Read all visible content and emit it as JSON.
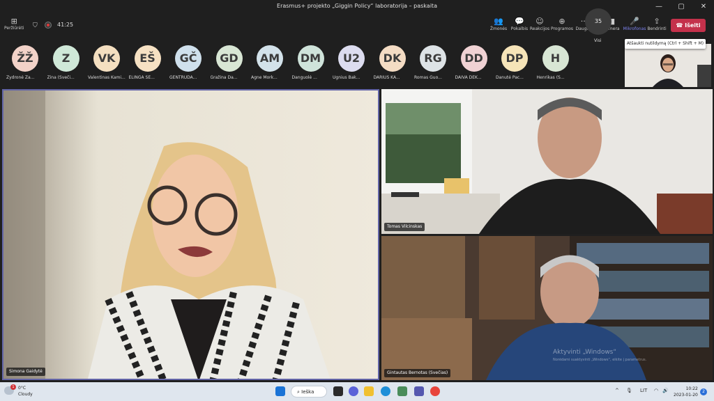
{
  "window": {
    "title": "Erasmus+ projekto „Giggin Policy“ laboratorija – paskaita",
    "minimize": "—",
    "maximize": "▢",
    "close": "✕"
  },
  "toolbar": {
    "layout_label": "Peržiūrėti",
    "timer": "41:25",
    "people_label": "Žmonės",
    "chat_label": "Pokalbis",
    "reactions_label": "Reakcijos",
    "apps_label": "Programos",
    "more_label": "Daugiau",
    "camera_label": "Kamera",
    "mic_label": "Mikrofonas",
    "share_label": "Bendrinti",
    "leave_label": "Išeiti",
    "unmute_tooltip": "Atšaukti nutildymą (Ctrl + Shift + M)"
  },
  "participants": [
    {
      "initials": "ŽŽ",
      "name": "Žydronė Ža...",
      "color": "#f2d2c8"
    },
    {
      "initials": "Z",
      "name": "Zina (Sveči...",
      "color": "#cfe8d8"
    },
    {
      "initials": "VK",
      "name": "Valentinas Kami...",
      "color": "#f4dfc0"
    },
    {
      "initials": "EŠ",
      "name": "ELINGA ŠE...",
      "color": "#f6e1c3"
    },
    {
      "initials": "GČ",
      "name": "GENTRŪDA...",
      "color": "#cfe0ec"
    },
    {
      "initials": "GD",
      "name": "Gražina Da...",
      "color": "#d8e6d4"
    },
    {
      "initials": "AM",
      "name": "Agne Mork...",
      "color": "#d3e2ea"
    },
    {
      "initials": "DM",
      "name": "Danguolė ...",
      "color": "#cfe3da"
    },
    {
      "initials": "U2",
      "name": "Ugnius Bak...",
      "color": "#dcdcef"
    },
    {
      "initials": "DK",
      "name": "DARIUS KA...",
      "color": "#f4dcc4"
    },
    {
      "initials": "RG",
      "name": "Romas Guo...",
      "color": "#dde3e6"
    },
    {
      "initials": "DD",
      "name": "DAIVA DEK...",
      "color": "#f0d2d4"
    },
    {
      "initials": "DP",
      "name": "Danutė Pac...",
      "color": "#f6e4b8"
    },
    {
      "initials": "H",
      "name": "Henrikas (S...",
      "color": "#d8e6d4"
    }
  ],
  "more_participants": {
    "count": "35",
    "label": "Visi"
  },
  "videos": {
    "main_name": "Simona Gaidytė",
    "top_right_name": "Tomas Vilcinskas",
    "bottom_right_name": "Gintautas Bernotas (Svečias)",
    "watermark_line1": "Aktyvinti „Windows“",
    "watermark_line2": "Norėdami suaktyvinti „Windows“, eikite į parametrus."
  },
  "taskbar": {
    "temperature": "0°C",
    "weather": "Cloudy",
    "weather_badge": "1",
    "search_label": "Ieška",
    "language": "LIT",
    "time": "10:22",
    "date": "2023-01-20",
    "notification_count": "2"
  }
}
